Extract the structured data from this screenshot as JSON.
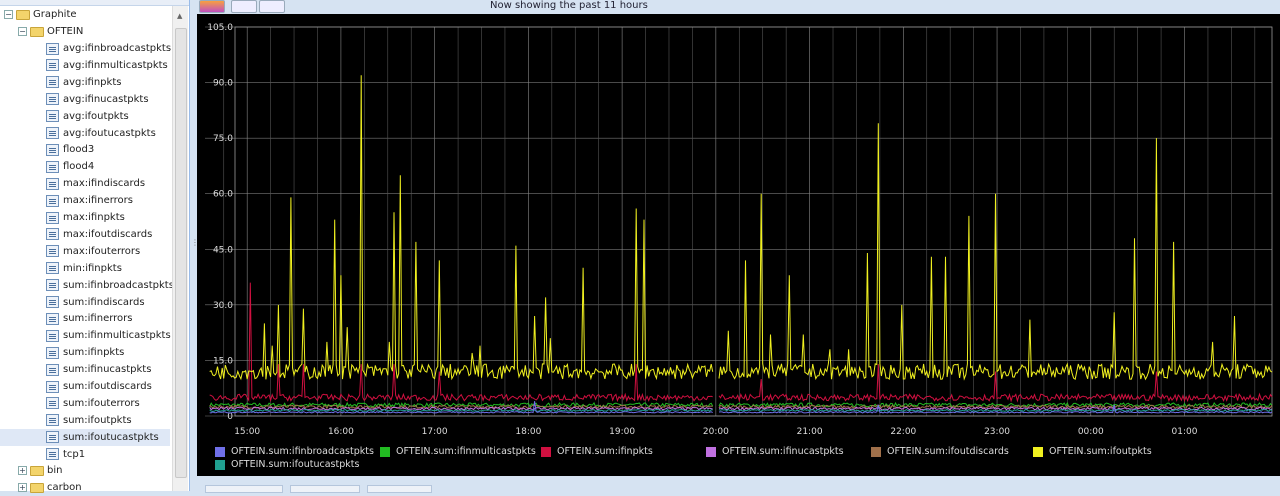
{
  "tree": {
    "root": "Graphite",
    "group": "OFTEIN",
    "items": [
      "avg:ifinbroadcastpkts",
      "avg:ifinmulticastpkts",
      "avg:ifinpkts",
      "avg:ifinucastpkts",
      "avg:ifoutpkts",
      "avg:ifoutucastpkts",
      "flood3",
      "flood4",
      "max:ifindiscards",
      "max:ifinerrors",
      "max:ifinpkts",
      "max:ifoutdiscards",
      "max:ifouterrors",
      "min:ifinpkts",
      "sum:ifinbroadcastpkts",
      "sum:ifindiscards",
      "sum:ifinerrors",
      "sum:ifinmulticastpkts",
      "sum:ifinpkts",
      "sum:ifinucastpkts",
      "sum:ifoutdiscards",
      "sum:ifouterrors",
      "sum:ifoutpkts",
      "sum:ifoutucastpkts",
      "tcp1"
    ],
    "selected": "sum:ifoutucastpkts",
    "siblings": [
      "bin",
      "carbon"
    ]
  },
  "toolbar": {
    "status": "Now showing the past 11 hours"
  },
  "chart_data": {
    "type": "line",
    "background": "#000000",
    "grid": true,
    "ylim": [
      0,
      105
    ],
    "yticks": [
      "105.0",
      "90.0",
      "75.0",
      "60.0",
      "45.0",
      "30.0",
      "15.0",
      "0"
    ],
    "ytick_values": [
      105,
      90,
      75,
      60,
      45,
      30,
      15,
      0
    ],
    "xlim": [
      "14:33",
      "01:56"
    ],
    "xticks": [
      "15:00",
      "16:00",
      "17:00",
      "18:00",
      "19:00",
      "20:00",
      "21:00",
      "22:00",
      "23:00",
      "00:00",
      "01:00"
    ],
    "data_gap": "20:00",
    "legend_placement": "bottom",
    "series": [
      {
        "name": "OFTEIN.sum:ifinbroadcastpkts",
        "color": "#6f6fe8",
        "baseline": 1,
        "spikes": [
          [
            "18:04",
            4
          ],
          [
            "21:44",
            3
          ],
          [
            "00:15",
            3
          ]
        ]
      },
      {
        "name": "OFTEIN.sum:ifinmulticastpkts",
        "color": "#22bb22",
        "baseline": 3,
        "spikes": []
      },
      {
        "name": "OFTEIN.sum:ifinpkts",
        "color": "#d01040",
        "baseline": 5,
        "spikes": [
          [
            "15:02",
            36
          ],
          [
            "15:20",
            14
          ],
          [
            "15:36",
            14
          ],
          [
            "16:13",
            14
          ],
          [
            "16:34",
            14
          ],
          [
            "17:03",
            12
          ],
          [
            "19:09",
            14
          ],
          [
            "20:29",
            10
          ],
          [
            "21:44",
            14
          ],
          [
            "22:59",
            12
          ],
          [
            "00:42",
            12
          ]
        ]
      },
      {
        "name": "OFTEIN.sum:ifinucastpkts",
        "color": "#c070e0",
        "baseline": 2,
        "spikes": []
      },
      {
        "name": "OFTEIN.sum:ifoutdiscards",
        "color": "#a0704a",
        "baseline": 2.5,
        "spikes": []
      },
      {
        "name": "OFTEIN.sum:ifoutpkts",
        "color": "#f0f020",
        "baseline": 12,
        "spikes": [
          [
            "15:11",
            25
          ],
          [
            "15:16",
            19
          ],
          [
            "15:20",
            30
          ],
          [
            "15:28",
            59
          ],
          [
            "15:36",
            29
          ],
          [
            "15:51",
            20
          ],
          [
            "15:56",
            53
          ],
          [
            "16:00",
            38
          ],
          [
            "16:04",
            24
          ],
          [
            "16:13",
            92
          ],
          [
            "16:31",
            20
          ],
          [
            "16:34",
            55
          ],
          [
            "16:38",
            65
          ],
          [
            "16:48",
            47
          ],
          [
            "17:03",
            42
          ],
          [
            "17:24",
            17
          ],
          [
            "17:29",
            19
          ],
          [
            "17:52",
            46
          ],
          [
            "18:04",
            27
          ],
          [
            "18:11",
            32
          ],
          [
            "18:14",
            21
          ],
          [
            "18:35",
            40
          ],
          [
            "19:09",
            56
          ],
          [
            "19:14",
            53
          ],
          [
            "20:01",
            18
          ],
          [
            "20:08",
            23
          ],
          [
            "20:19",
            42
          ],
          [
            "20:29",
            60
          ],
          [
            "20:35",
            22
          ],
          [
            "20:47",
            38
          ],
          [
            "20:56",
            22
          ],
          [
            "21:13",
            18
          ],
          [
            "21:25",
            18
          ],
          [
            "21:37",
            44
          ],
          [
            "21:44",
            79
          ],
          [
            "21:59",
            30
          ],
          [
            "22:18",
            43
          ],
          [
            "22:27",
            43
          ],
          [
            "22:42",
            54
          ],
          [
            "22:59",
            60
          ],
          [
            "23:21",
            26
          ],
          [
            "00:15",
            28
          ],
          [
            "00:28",
            48
          ],
          [
            "00:42",
            75
          ],
          [
            "00:53",
            47
          ],
          [
            "01:18",
            20
          ],
          [
            "01:32",
            27
          ]
        ]
      },
      {
        "name": "OFTEIN.sum:ifoutucastpkts",
        "color": "#20a090",
        "baseline": 1.5,
        "spikes": []
      }
    ]
  }
}
